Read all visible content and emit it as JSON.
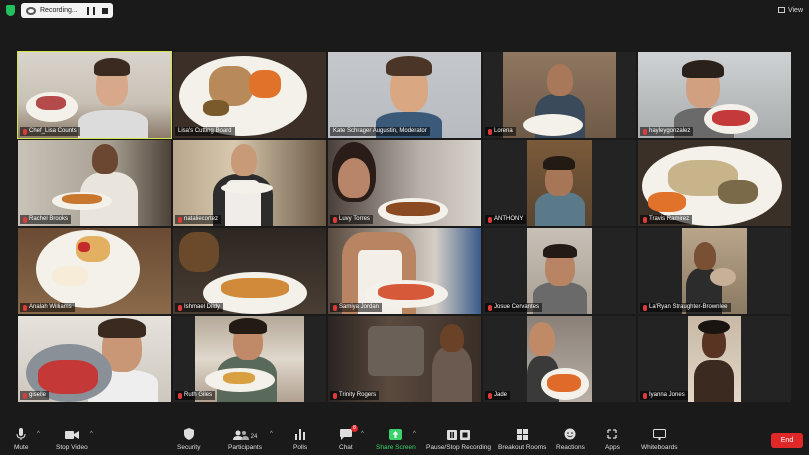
{
  "recording": {
    "label": "Recording..."
  },
  "view": {
    "label": "View"
  },
  "participants": [
    {
      "name": "Chef_Lisa Counts",
      "muted": true,
      "active": true
    },
    {
      "name": "Lisa's Cutting Board",
      "muted": false,
      "active": false
    },
    {
      "name": "Kate Schrager Augustin, Moderator",
      "muted": false,
      "active": false
    },
    {
      "name": "Lorena",
      "muted": true,
      "active": false
    },
    {
      "name": "hayleygonzalez",
      "muted": true,
      "active": false
    },
    {
      "name": "Rachel Brooks",
      "muted": true,
      "active": false
    },
    {
      "name": "nataliecortez",
      "muted": true,
      "active": false
    },
    {
      "name": "Luvy Torres",
      "muted": true,
      "active": false
    },
    {
      "name": "ANTHONY",
      "muted": true,
      "active": false
    },
    {
      "name": "Travis Ramirez",
      "muted": true,
      "active": false
    },
    {
      "name": "Analah Williams",
      "muted": true,
      "active": false
    },
    {
      "name": "Ishmael Dildy",
      "muted": true,
      "active": false
    },
    {
      "name": "Samiya Jordan",
      "muted": true,
      "active": false
    },
    {
      "name": "Josue Cervantes",
      "muted": true,
      "active": false
    },
    {
      "name": "La'Ryan Straughter-Brownlee",
      "muted": true,
      "active": false
    },
    {
      "name": "giselle",
      "muted": true,
      "active": false
    },
    {
      "name": "Ruth Giles",
      "muted": true,
      "active": false
    },
    {
      "name": "Trinity Rogers",
      "muted": true,
      "active": false
    },
    {
      "name": "Jade",
      "muted": true,
      "active": false
    },
    {
      "name": "Iyanna Jones",
      "muted": true,
      "active": false
    }
  ],
  "toolbar": {
    "mute": "Mute",
    "stop_video": "Stop Video",
    "security": "Security",
    "participants": "Participants",
    "participants_count": "24",
    "polls": "Polls",
    "chat": "Chat",
    "chat_badge": "8",
    "share_screen": "Share Screen",
    "recording": "Pause/Stop Recording",
    "breakout_rooms": "Breakout Rooms",
    "reactions": "Reactions",
    "apps": "Apps",
    "whiteboards": "Whiteboards",
    "end": "End"
  },
  "colors": {
    "active_border": "#cfe34a",
    "share_green": "#3ad26b",
    "end_red": "#e02828",
    "muted_red": "#e03b3b"
  }
}
